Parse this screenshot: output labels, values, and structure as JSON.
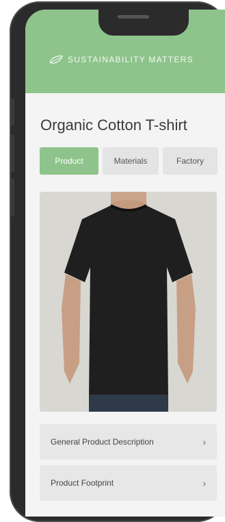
{
  "header": {
    "brand": "SUSTAINABILITY MATTERS",
    "brand_icon": "leaf-icon",
    "color": "#8ec48b"
  },
  "product": {
    "title": "Organic Cotton T-shirt",
    "image": "black-tshirt-photo"
  },
  "tabs": [
    {
      "label": "Product",
      "active": true
    },
    {
      "label": "Materials",
      "active": false
    },
    {
      "label": "Factory",
      "active": false
    }
  ],
  "sections": [
    {
      "label": "General Product Description",
      "icon": "chevron-right-icon"
    },
    {
      "label": "Product Footprint",
      "icon": "chevron-right-icon"
    }
  ],
  "chevron": "›"
}
